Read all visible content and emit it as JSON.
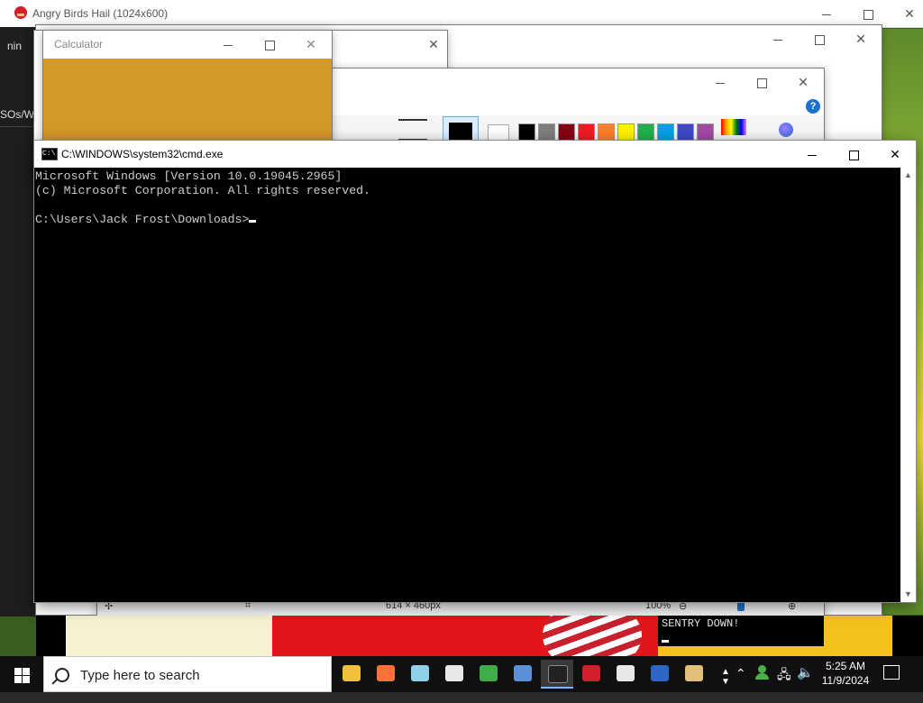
{
  "angry_birds": {
    "title": "Angry Birds Hail (1024x600)"
  },
  "left_strip": {
    "text1": "nin",
    "text2": "SOs/Wi"
  },
  "calculator": {
    "title": "Calculator"
  },
  "paint": {
    "swatch_colors": [
      "#000000",
      "#7f7f7f",
      "#880015",
      "#ed1c24",
      "#ff7f27",
      "#fff200",
      "#22b14c",
      "#00a2e8",
      "#3f48cc",
      "#a349a4"
    ],
    "zoom": "100%",
    "size": "614 × 460px"
  },
  "cmd": {
    "title": "C:\\WINDOWS\\system32\\cmd.exe",
    "lines": [
      "Microsoft Windows [Version 10.0.19045.2965]",
      "(c) Microsoft Corporation. All rights reserved.",
      "",
      "C:\\Users\\Jack Frost\\Downloads>"
    ]
  },
  "game": {
    "banner": "SENTRY DOWN!"
  },
  "taskbar": {
    "search_placeholder": "Type here to search",
    "time": "5:25 AM",
    "date": "11/9/2024",
    "pinned": [
      {
        "name": "file-explorer-icon",
        "color": "#f2c037"
      },
      {
        "name": "firefox-icon",
        "color": "#ff7139"
      },
      {
        "name": "notepad-plus-icon",
        "color": "#8fd0e8"
      },
      {
        "name": "app-window-icon",
        "color": "#e8e8e8"
      },
      {
        "name": "users-icon",
        "color": "#3fae49"
      },
      {
        "name": "network-app-icon",
        "color": "#5b8fd6"
      },
      {
        "name": "cmd-icon",
        "color": "#222222"
      },
      {
        "name": "angry-birds-icon",
        "color": "#d21f2b"
      },
      {
        "name": "window-app-icon",
        "color": "#e8e8e8"
      },
      {
        "name": "x-app-icon",
        "color": "#2c67c7"
      },
      {
        "name": "paint-icon",
        "color": "#e3c07a"
      }
    ]
  }
}
